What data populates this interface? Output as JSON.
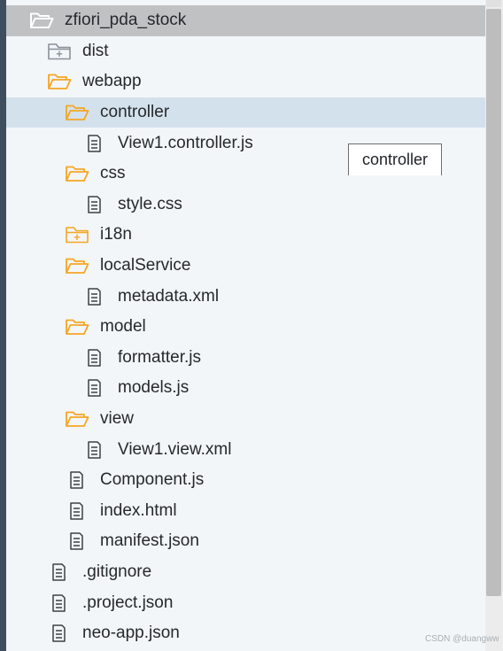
{
  "tree": {
    "root": {
      "label": "zfiori_pda_stock",
      "icon": "folder-open-icon"
    },
    "items": [
      {
        "label": "dist",
        "icon": "folder-collapsed-icon",
        "depth": 1
      },
      {
        "label": "webapp",
        "icon": "folder-open-icon",
        "depth": 1
      },
      {
        "label": "controller",
        "icon": "folder-open-icon",
        "depth": 2,
        "selected": true
      },
      {
        "label": "View1.controller.js",
        "icon": "file-icon",
        "depth": 3
      },
      {
        "label": "css",
        "icon": "folder-open-icon",
        "depth": 2
      },
      {
        "label": "style.css",
        "icon": "file-icon",
        "depth": 3
      },
      {
        "label": "i18n",
        "icon": "folder-collapsed-icon",
        "depth": 2
      },
      {
        "label": "localService",
        "icon": "folder-open-icon",
        "depth": 2
      },
      {
        "label": "metadata.xml",
        "icon": "file-icon",
        "depth": 3
      },
      {
        "label": "model",
        "icon": "folder-open-icon",
        "depth": 2
      },
      {
        "label": "formatter.js",
        "icon": "file-icon",
        "depth": 3
      },
      {
        "label": "models.js",
        "icon": "file-icon",
        "depth": 3
      },
      {
        "label": "view",
        "icon": "folder-open-icon",
        "depth": 2
      },
      {
        "label": "View1.view.xml",
        "icon": "file-icon",
        "depth": 3
      },
      {
        "label": "Component.js",
        "icon": "file-icon",
        "depth": 2
      },
      {
        "label": "index.html",
        "icon": "file-icon",
        "depth": 2
      },
      {
        "label": "manifest.json",
        "icon": "file-icon",
        "depth": 2
      },
      {
        "label": ".gitignore",
        "icon": "file-icon",
        "depth": 1
      },
      {
        "label": ".project.json",
        "icon": "file-icon",
        "depth": 1
      },
      {
        "label": "neo-app.json",
        "icon": "file-icon",
        "depth": 1
      }
    ]
  },
  "tooltip": {
    "text": "controller"
  },
  "watermark": "CSDN @duangww",
  "colors": {
    "folder_orange": "#f5a623",
    "folder_gray": "#8a9199",
    "selected_row": "#d3e1ec",
    "root_bar": "#bfc1c3"
  }
}
